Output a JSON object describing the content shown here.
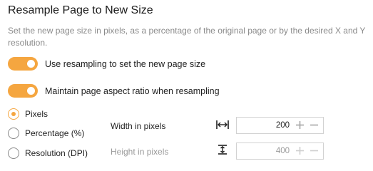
{
  "header": {
    "title": "Resample Page to New Size",
    "description": "Set the new page size in pixels, as a percentage of the original page or by the desired X and Y resolution."
  },
  "toggles": [
    {
      "label": "Use resampling to set the new page size",
      "on": true
    },
    {
      "label": "Maintain page aspect ratio when resampling",
      "on": true
    }
  ],
  "size_mode": {
    "options": [
      "Pixels",
      "Percentage (%)",
      "Resolution (DPI)"
    ],
    "selected": "Pixels"
  },
  "fields": {
    "width": {
      "label": "Width in pixels",
      "value": "200",
      "icon": "width-arrows-icon"
    },
    "height": {
      "label": "Height in pixels",
      "value": "400",
      "icon": "height-arrows-icon",
      "disabled": true
    }
  },
  "colors": {
    "accent": "#f5a640",
    "disabled_text": "#9a9a9a"
  }
}
